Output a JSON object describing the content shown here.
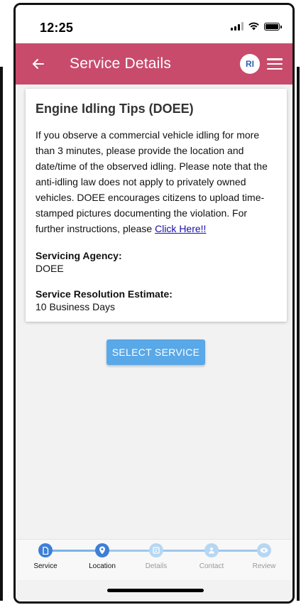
{
  "status_bar": {
    "time": "12:25"
  },
  "app_bar": {
    "title": "Service Details",
    "avatar_initials": "RI",
    "brand_color": "#c84b6c"
  },
  "card": {
    "title": "Engine Idling Tips (DOEE)",
    "description": "If you observe a commercial vehicle idling for more than 3 minutes, please provide the location and date/time of the observed idling. Please note that the anti-idling law does not apply to privately owned vehicles. DOEE encourages citizens to upload time-stamped pictures documenting the violation. For further instructions, please ",
    "link_text": "Click Here!!",
    "agency_label": "Servicing Agency:",
    "agency_value": "DOEE",
    "estimate_label": "Service Resolution Estimate:",
    "estimate_value": "10 Business Days"
  },
  "actions": {
    "select_service_label": "SELECT SERVICE",
    "button_color": "#59a8e8"
  },
  "stepper": {
    "steps": [
      {
        "label": "Service",
        "icon": "document-icon",
        "state": "active"
      },
      {
        "label": "Location",
        "icon": "location-pin-icon",
        "state": "active"
      },
      {
        "label": "Details",
        "icon": "details-icon",
        "state": "inactive"
      },
      {
        "label": "Contact",
        "icon": "person-icon",
        "state": "inactive"
      },
      {
        "label": "Review",
        "icon": "eye-icon",
        "state": "inactive"
      }
    ]
  },
  "icons": {
    "back": "arrow-left-icon",
    "menu": "hamburger-menu-icon",
    "signal": "cellular-signal-icon",
    "wifi": "wifi-icon",
    "battery": "battery-icon"
  }
}
